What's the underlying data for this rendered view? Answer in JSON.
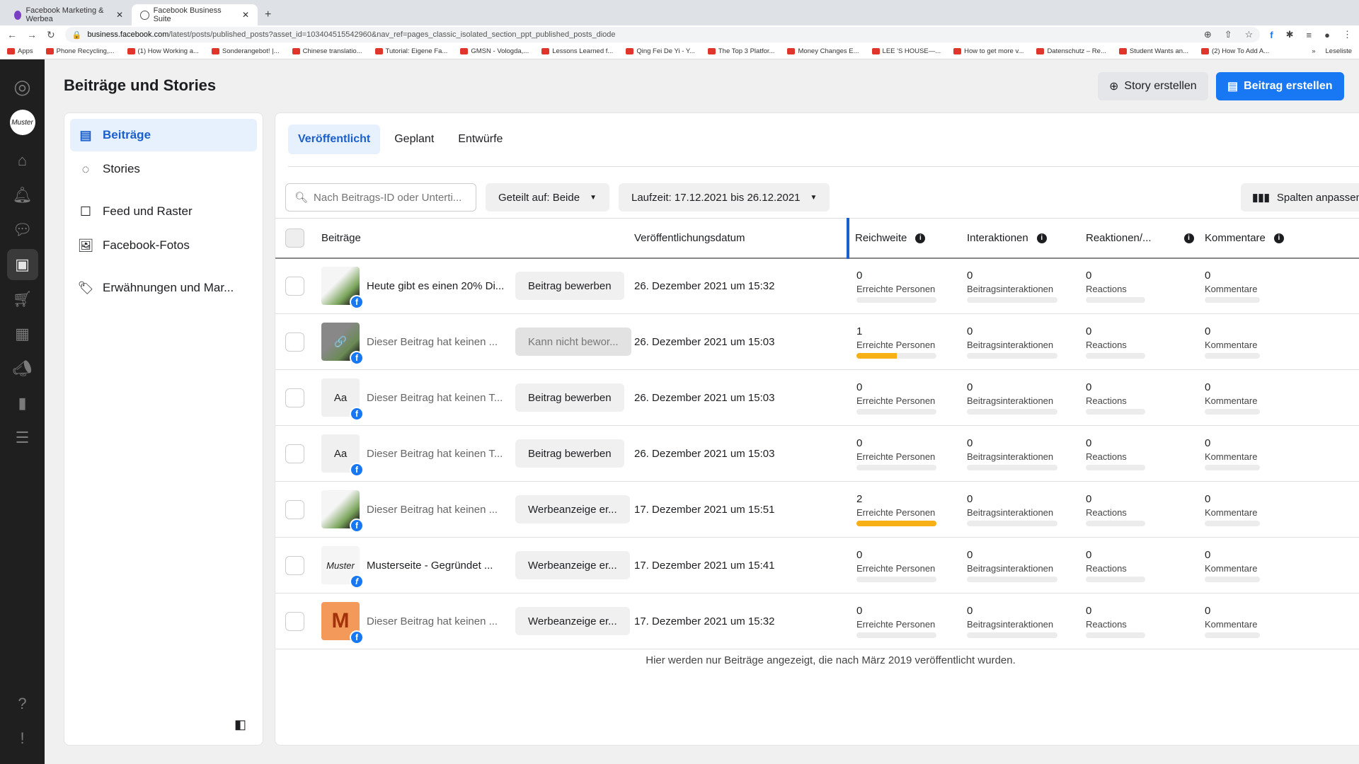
{
  "browser": {
    "tabs": [
      {
        "title": "Facebook Marketing & Werbea",
        "active": false
      },
      {
        "title": "Facebook Business Suite",
        "active": true
      }
    ],
    "url_host": "business.facebook.com",
    "url_path": "/latest/posts/published_posts?asset_id=103404515542960&nav_ref=pages_classic_isolated_section_ppt_published_posts_diode",
    "bookmarks": [
      "Apps",
      "Phone Recycling,...",
      "(1) How Working a...",
      "Sonderangebot! |...",
      "Chinese translatio...",
      "Tutorial: Eigene Fa...",
      "GMSN - Vologda,...",
      "Lessons Learned f...",
      "Qing Fei De Yi - Y...",
      "The Top 3 Platfor...",
      "Money Changes E...",
      "LEE 'S HOUSE—...",
      "How to get more v...",
      "Datenschutz – Re...",
      "Student Wants an...",
      "(2) How To Add A..."
    ],
    "reading_list": "Leseliste"
  },
  "header": {
    "title": "Beiträge und Stories",
    "story_button": "Story erstellen",
    "post_button": "Beitrag erstellen"
  },
  "leftnav": {
    "items": [
      {
        "label": "Beiträge",
        "icon": "posts-icon",
        "active": true
      },
      {
        "label": "Stories",
        "icon": "stories-icon"
      },
      {
        "label": "Feed und Raster",
        "icon": "feed-icon"
      },
      {
        "label": "Facebook-Fotos",
        "icon": "photos-icon"
      },
      {
        "label": "Erwähnungen und Mar...",
        "icon": "tag-icon"
      }
    ]
  },
  "tabs": [
    "Veröffentlicht",
    "Geplant",
    "Entwürfe"
  ],
  "filters": {
    "search_placeholder": "Nach Beitrags-ID oder Unterti...",
    "shared_on": "Geteilt auf: Beide",
    "date_range": "Laufzeit: 17.12.2021 bis 26.12.2021",
    "columns_button": "Spalten anpassen"
  },
  "table": {
    "headers": [
      "Beiträge",
      "Veröffentlichungsdatum",
      "Reichweite",
      "Interaktionen",
      "Reaktionen/...",
      "Kommentare"
    ],
    "metric_labels": [
      "Erreichte Personen",
      "Beitragsinteraktionen",
      "Reactions",
      "Kommentare"
    ],
    "rows": [
      {
        "thumb": "grad",
        "thumb_text": "",
        "text": "Heute gibt es einen 20% Di...",
        "muted": false,
        "action": "Beitrag bewerben",
        "disabled": false,
        "date": "26. Dezember 2021 um 15:32",
        "reach": "0",
        "reach_fill": 0,
        "interactions": "0",
        "reactions": "0",
        "comments": "0"
      },
      {
        "thumb": "gray",
        "thumb_text": "🔗",
        "text": "Dieser Beitrag hat keinen ...",
        "muted": true,
        "action": "Kann nicht bewor...",
        "disabled": true,
        "date": "26. Dezember 2021 um 15:03",
        "reach": "1",
        "reach_fill": 0.5,
        "interactions": "0",
        "reactions": "0",
        "comments": "0"
      },
      {
        "thumb": "aa",
        "thumb_text": "Aa",
        "text": "Dieser Beitrag hat keinen T...",
        "muted": true,
        "action": "Beitrag bewerben",
        "disabled": false,
        "date": "26. Dezember 2021 um 15:03",
        "reach": "0",
        "reach_fill": 0,
        "interactions": "0",
        "reactions": "0",
        "comments": "0"
      },
      {
        "thumb": "aa",
        "thumb_text": "Aa",
        "text": "Dieser Beitrag hat keinen T...",
        "muted": true,
        "action": "Beitrag bewerben",
        "disabled": false,
        "date": "26. Dezember 2021 um 15:03",
        "reach": "0",
        "reach_fill": 0,
        "interactions": "0",
        "reactions": "0",
        "comments": "0"
      },
      {
        "thumb": "grad",
        "thumb_text": "",
        "text": "Dieser Beitrag hat keinen ...",
        "muted": true,
        "action": "Werbeanzeige er...",
        "disabled": false,
        "date": "17. Dezember 2021 um 15:51",
        "reach": "2",
        "reach_fill": 1,
        "interactions": "0",
        "reactions": "0",
        "comments": "0"
      },
      {
        "thumb": "logo",
        "thumb_text": "Muster",
        "text": "Musterseite - Gegründet ...",
        "muted": false,
        "action": "Werbeanzeige er...",
        "disabled": false,
        "date": "17. Dezember 2021 um 15:41",
        "reach": "0",
        "reach_fill": 0,
        "interactions": "0",
        "reactions": "0",
        "comments": "0"
      },
      {
        "thumb": "m",
        "thumb_text": "M",
        "text": "Dieser Beitrag hat keinen ...",
        "muted": true,
        "action": "Werbeanzeige er...",
        "disabled": false,
        "date": "17. Dezember 2021 um 15:32",
        "reach": "0",
        "reach_fill": 0,
        "interactions": "0",
        "reactions": "0",
        "comments": "0"
      }
    ]
  },
  "footer_note": "Hier werden nur Beiträge angezeigt, die nach März 2019 veröffentlicht wurden.",
  "colors": {
    "accent": "#1877f2",
    "active_text": "#1b5fcc",
    "reach_bar": "#f7b016",
    "rail": "#1f1f1f"
  }
}
